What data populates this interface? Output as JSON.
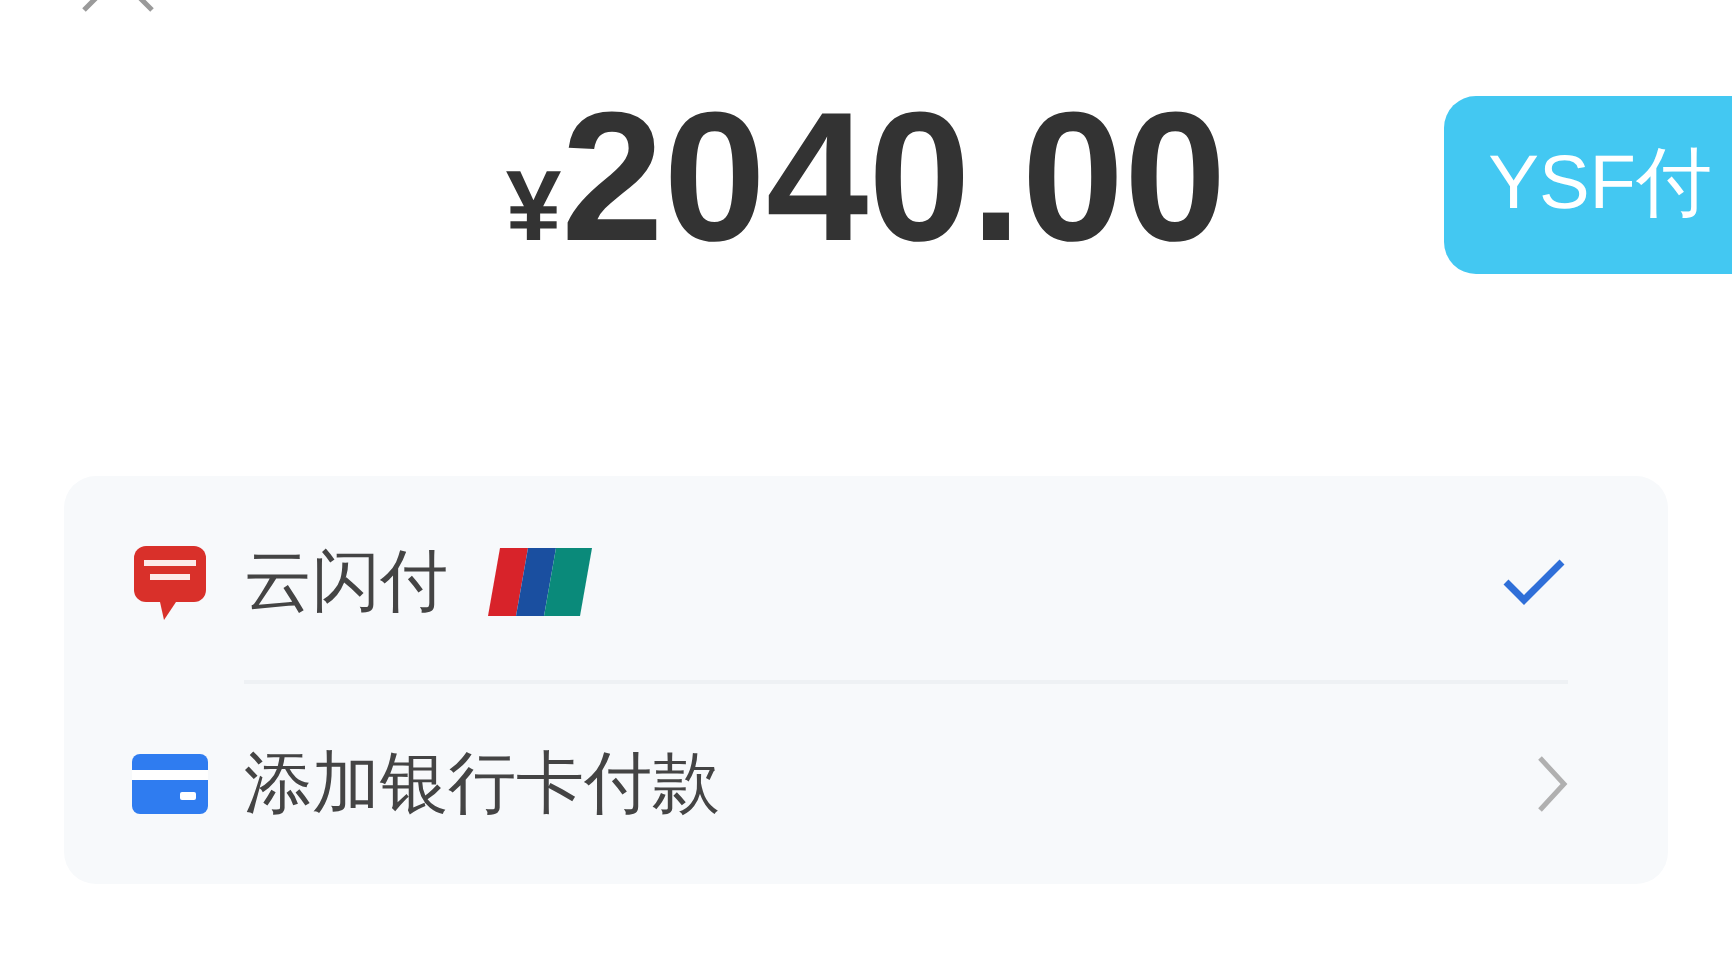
{
  "amount": {
    "currency": "¥",
    "value": "2040.00"
  },
  "badge": "YSF付",
  "payment_methods": [
    {
      "kind": "app",
      "label": "云闪付",
      "selected": true
    },
    {
      "kind": "card",
      "label": "添加银行卡付款",
      "selected": false
    }
  ]
}
